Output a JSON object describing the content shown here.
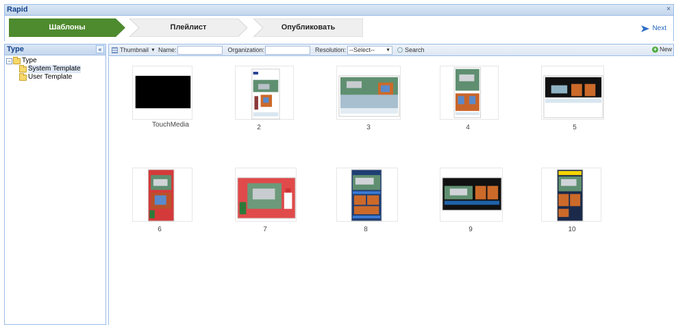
{
  "window": {
    "title": "Rapid",
    "close_glyph": "×"
  },
  "steps": [
    {
      "label": "Шаблоны",
      "active": true
    },
    {
      "label": "Плейлист",
      "active": false
    },
    {
      "label": "Опубликовать",
      "active": false
    }
  ],
  "next": {
    "label": "Next",
    "icon": "arrow-right-icon"
  },
  "left_panel": {
    "title": "Type",
    "collapse_glyph": "«",
    "tree": {
      "root": "Type",
      "children": [
        "System Template",
        "User Template"
      ],
      "selected": "System Template"
    }
  },
  "toolbar": {
    "view_label": "Thumbnail",
    "name_label": "Name:",
    "name_value": "",
    "org_label": "Organization:",
    "org_value": "",
    "resolution_label": "Resolution:",
    "resolution_value": "--Select--",
    "search_label": "Search",
    "new_label": "New"
  },
  "templates": [
    {
      "caption": "TouchMedia",
      "style": "black"
    },
    {
      "caption": "2",
      "style": "portrait-green"
    },
    {
      "caption": "3",
      "style": "landscape-green"
    },
    {
      "caption": "4",
      "style": "portrait-orange"
    },
    {
      "caption": "5",
      "style": "landscape-dark"
    },
    {
      "caption": "6",
      "style": "portrait-red"
    },
    {
      "caption": "7",
      "style": "landscape-red"
    },
    {
      "caption": "8",
      "style": "portrait-blue"
    },
    {
      "caption": "9",
      "style": "landscape-black"
    },
    {
      "caption": "10",
      "style": "portrait-yellow"
    }
  ],
  "colors": {
    "active_step": "#4e8a2e",
    "inactive_step": "#efefef",
    "accent": "#15428b"
  }
}
